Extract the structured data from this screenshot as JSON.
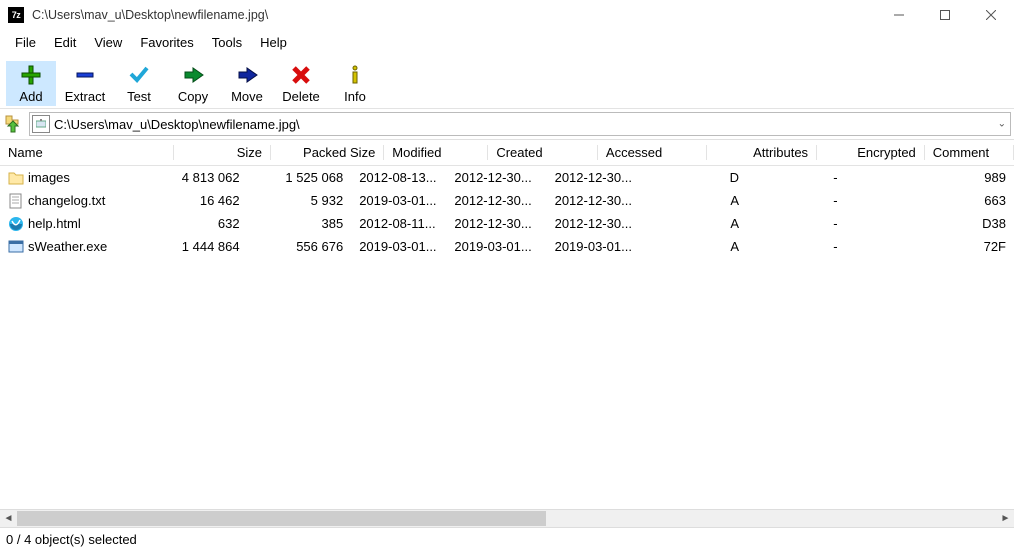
{
  "title": "C:\\Users\\mav_u\\Desktop\\newfilename.jpg\\",
  "menu": [
    "File",
    "Edit",
    "View",
    "Favorites",
    "Tools",
    "Help"
  ],
  "toolbar": [
    {
      "label": "Add"
    },
    {
      "label": "Extract"
    },
    {
      "label": "Test"
    },
    {
      "label": "Copy"
    },
    {
      "label": "Move"
    },
    {
      "label": "Delete"
    },
    {
      "label": "Info"
    }
  ],
  "path": "C:\\Users\\mav_u\\Desktop\\newfilename.jpg\\",
  "columns": [
    "Name",
    "Size",
    "Packed Size",
    "Modified",
    "Created",
    "Accessed",
    "Attributes",
    "Encrypted",
    "Comment"
  ],
  "rows": [
    {
      "icon": "folder",
      "name": "images",
      "size": "4 813 062",
      "psize": "1 525 068",
      "mod": "2012-08-13...",
      "crt": "2012-12-30...",
      "acc": "2012-12-30...",
      "attr": "D",
      "enc": "-",
      "cmt": "",
      "crc": "989"
    },
    {
      "icon": "txt",
      "name": "changelog.txt",
      "size": "16 462",
      "psize": "5 932",
      "mod": "2019-03-01...",
      "crt": "2012-12-30...",
      "acc": "2012-12-30...",
      "attr": "A",
      "enc": "-",
      "cmt": "",
      "crc": "663"
    },
    {
      "icon": "html",
      "name": "help.html",
      "size": "632",
      "psize": "385",
      "mod": "2012-08-11...",
      "crt": "2012-12-30...",
      "acc": "2012-12-30...",
      "attr": "A",
      "enc": "-",
      "cmt": "",
      "crc": "D38"
    },
    {
      "icon": "exe",
      "name": "sWeather.exe",
      "size": "1 444 864",
      "psize": "556 676",
      "mod": "2019-03-01...",
      "crt": "2019-03-01...",
      "acc": "2019-03-01...",
      "attr": "A",
      "enc": "-",
      "cmt": "",
      "crc": "72F"
    }
  ],
  "status": "0 / 4 object(s) selected"
}
